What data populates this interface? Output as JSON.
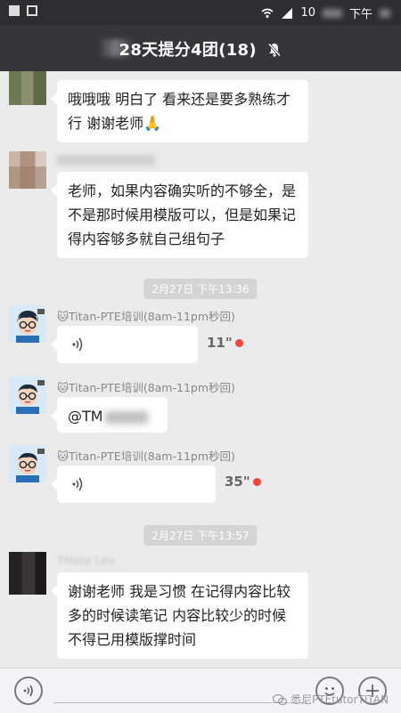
{
  "status_bar": {
    "time_partial": "10",
    "period": "下午"
  },
  "header": {
    "title": "28天提分4团(18)"
  },
  "messages": [
    {
      "text": "哦哦哦 明白了 看来还是要多熟练才行 谢谢老师🙏"
    },
    {
      "text": "老师，如果内容确实听的不够全，是不是那时候用模版可以，但是如果记得内容够多就自己组句子"
    },
    {
      "timestamp": "2月27日 下午13:36"
    },
    {
      "sender": "🐱Titan-PTE培训(8am-11pm秒回)",
      "duration": "11\""
    },
    {
      "sender": "🐱Titan-PTE培训(8am-11pm秒回)",
      "text": "@TM"
    },
    {
      "sender": "🐱Titan-PTE培训(8am-11pm秒回)",
      "duration": "35\""
    },
    {
      "timestamp": "2月27日 下午13:57"
    },
    {
      "sender": "TMate Leo",
      "text": "谢谢老师 我是习惯 在记得内容比较多的时候读笔记 内容比较少的时候不得已用模版撑时间"
    }
  ],
  "watermark": {
    "text": "悉尼PTEtutorTITAN"
  },
  "colors": {
    "header_bg": "#35353a",
    "chat_bg": "#ebebeb",
    "unread": "#f0473b"
  }
}
